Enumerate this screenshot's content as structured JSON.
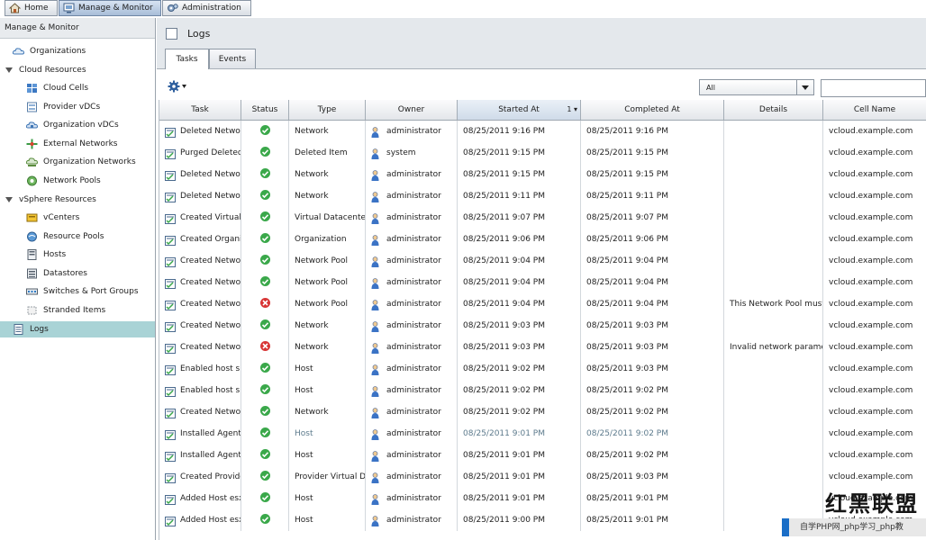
{
  "nav": {
    "tabs": [
      {
        "label": "Home"
      },
      {
        "label": "Manage & Monitor"
      },
      {
        "label": "Administration"
      }
    ]
  },
  "sidebar": {
    "title": "Manage & Monitor",
    "items": [
      {
        "label": "Organizations",
        "level": 0
      },
      {
        "label": "Cloud Resources",
        "level": "group"
      },
      {
        "label": "Cloud Cells",
        "level": 1
      },
      {
        "label": "Provider vDCs",
        "level": 1
      },
      {
        "label": "Organization vDCs",
        "level": 1
      },
      {
        "label": "External Networks",
        "level": 1
      },
      {
        "label": "Organization Networks",
        "level": 1
      },
      {
        "label": "Network Pools",
        "level": 1
      },
      {
        "label": "vSphere Resources",
        "level": "group"
      },
      {
        "label": "vCenters",
        "level": 1
      },
      {
        "label": "Resource Pools",
        "level": 1
      },
      {
        "label": "Hosts",
        "level": 1
      },
      {
        "label": "Datastores",
        "level": 1
      },
      {
        "label": "Switches & Port Groups",
        "level": 1
      },
      {
        "label": "Stranded Items",
        "level": 1
      },
      {
        "label": "Logs",
        "level": 0
      }
    ]
  },
  "main": {
    "title": "Logs",
    "tabs": [
      {
        "label": "Tasks"
      },
      {
        "label": "Events"
      }
    ],
    "filter": {
      "value": "All"
    },
    "table": {
      "columns": [
        "Task",
        "Status",
        "Type",
        "Owner",
        "Started At",
        "Completed At",
        "Details",
        "Cell Name"
      ],
      "sort": {
        "column": "Started At",
        "indicator": "1 ▾"
      },
      "rows": [
        [
          "Deleted Network",
          "ok",
          "Network",
          "administrator",
          "08/25/2011 9:16 PM",
          "08/25/2011 9:16 PM",
          "",
          "vcloud.example.com"
        ],
        [
          "Purged Deleted It",
          "ok",
          "Deleted Item",
          "system",
          "08/25/2011 9:15 PM",
          "08/25/2011 9:15 PM",
          "",
          "vcloud.example.com"
        ],
        [
          "Deleted Network",
          "ok",
          "Network",
          "administrator",
          "08/25/2011 9:15 PM",
          "08/25/2011 9:15 PM",
          "",
          "vcloud.example.com"
        ],
        [
          "Deleted Network",
          "ok",
          "Network",
          "administrator",
          "08/25/2011 9:11 PM",
          "08/25/2011 9:11 PM",
          "",
          "vcloud.example.com"
        ],
        [
          "Created Virtual D",
          "ok",
          "Virtual Datacenter",
          "administrator",
          "08/25/2011 9:07 PM",
          "08/25/2011 9:07 PM",
          "",
          "vcloud.example.com"
        ],
        [
          "Created Organiz",
          "ok",
          "Organization",
          "administrator",
          "08/25/2011 9:06 PM",
          "08/25/2011 9:06 PM",
          "",
          "vcloud.example.com"
        ],
        [
          "Created Network",
          "ok",
          "Network Pool",
          "administrator",
          "08/25/2011 9:04 PM",
          "08/25/2011 9:04 PM",
          "",
          "vcloud.example.com"
        ],
        [
          "Created Network",
          "ok",
          "Network Pool",
          "administrator",
          "08/25/2011 9:04 PM",
          "08/25/2011 9:04 PM",
          "",
          "vcloud.example.com"
        ],
        [
          "Created Network",
          "error",
          "Network Pool",
          "administrator",
          "08/25/2011 9:04 PM",
          "08/25/2011 9:04 PM",
          "This Network Pool must h",
          "vcloud.example.com"
        ],
        [
          "Created Network",
          "ok",
          "Network",
          "administrator",
          "08/25/2011 9:03 PM",
          "08/25/2011 9:03 PM",
          "",
          "vcloud.example.com"
        ],
        [
          "Created Network",
          "error",
          "Network",
          "administrator",
          "08/25/2011 9:03 PM",
          "08/25/2011 9:03 PM",
          "Invalid network paramet",
          "vcloud.example.com"
        ],
        [
          "Enabled host sp",
          "ok",
          "Host",
          "administrator",
          "08/25/2011 9:02 PM",
          "08/25/2011 9:03 PM",
          "",
          "vcloud.example.com"
        ],
        [
          "Enabled host sp",
          "ok",
          "Host",
          "administrator",
          "08/25/2011 9:02 PM",
          "08/25/2011 9:02 PM",
          "",
          "vcloud.example.com"
        ],
        [
          "Created Network",
          "ok",
          "Network",
          "administrator",
          "08/25/2011 9:02 PM",
          "08/25/2011 9:02 PM",
          "",
          "vcloud.example.com"
        ],
        [
          "Installed Agent",
          "ok",
          "Host",
          "administrator",
          "08/25/2011 9:01 PM",
          "08/25/2011 9:02 PM",
          "",
          "vcloud.example.com"
        ],
        [
          "Installed Agent",
          "ok",
          "Host",
          "administrator",
          "08/25/2011 9:01 PM",
          "08/25/2011 9:02 PM",
          "",
          "vcloud.example.com"
        ],
        [
          "Created Provider",
          "ok",
          "Provider Virtual Da",
          "administrator",
          "08/25/2011 9:01 PM",
          "08/25/2011 9:03 PM",
          "",
          "vcloud.example.com"
        ],
        [
          "Added Host esx0",
          "ok",
          "Host",
          "administrator",
          "08/25/2011 9:01 PM",
          "08/25/2011 9:01 PM",
          "",
          "vcloud.example.com"
        ],
        [
          "Added Host esx0",
          "ok",
          "Host",
          "administrator",
          "08/25/2011 9:00 PM",
          "08/25/2011 9:01 PM",
          "",
          "vcloud.example.com"
        ]
      ]
    }
  },
  "watermark": {
    "title": "红黑联盟",
    "caption": "自学PHP网_php学习_php教"
  },
  "colors": {
    "selected": "#a9d3d6",
    "ok": "#3aa84a",
    "error": "#d83535",
    "header_bg": "#e4e8ec"
  }
}
